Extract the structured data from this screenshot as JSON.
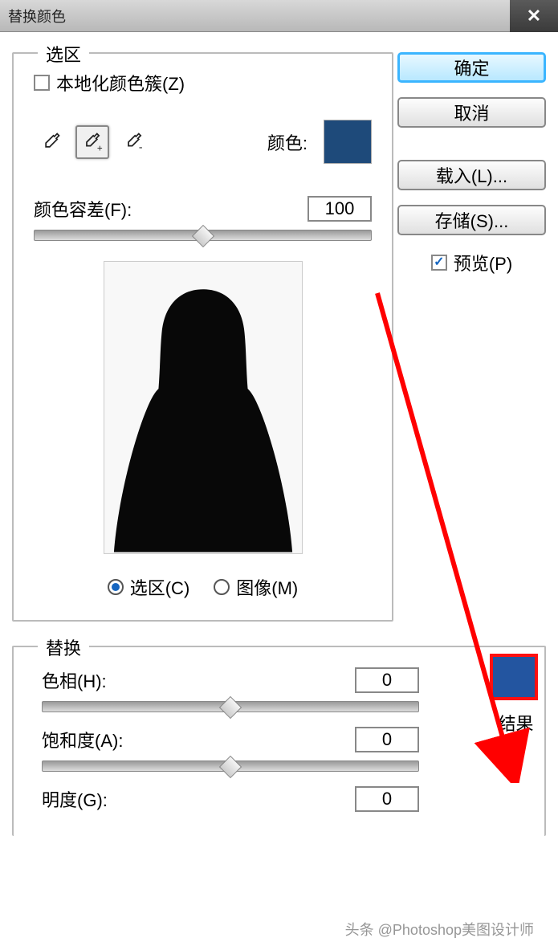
{
  "title": "替换颜色",
  "selection": {
    "legend": "选区",
    "localize_label": "本地化颜色簇(Z)",
    "localize_checked": false,
    "color_label": "颜色:",
    "color_value": "#1e4a7a",
    "fuzziness_label": "颜色容差(F):",
    "fuzziness_value": "100",
    "radio_selection": "选区(C)",
    "radio_image": "图像(M)"
  },
  "replacement": {
    "legend": "替换",
    "hue_label": "色相(H):",
    "hue_value": "0",
    "sat_label": "饱和度(A):",
    "sat_value": "0",
    "light_label": "明度(G):",
    "light_value": "0",
    "result_label": "结果",
    "result_color": "#2355a0"
  },
  "buttons": {
    "ok": "确定",
    "cancel": "取消",
    "load": "载入(L)...",
    "save": "存储(S)..."
  },
  "preview": {
    "label": "预览(P)",
    "checked": true
  },
  "watermark": "头条 @Photoshop美图设计师"
}
